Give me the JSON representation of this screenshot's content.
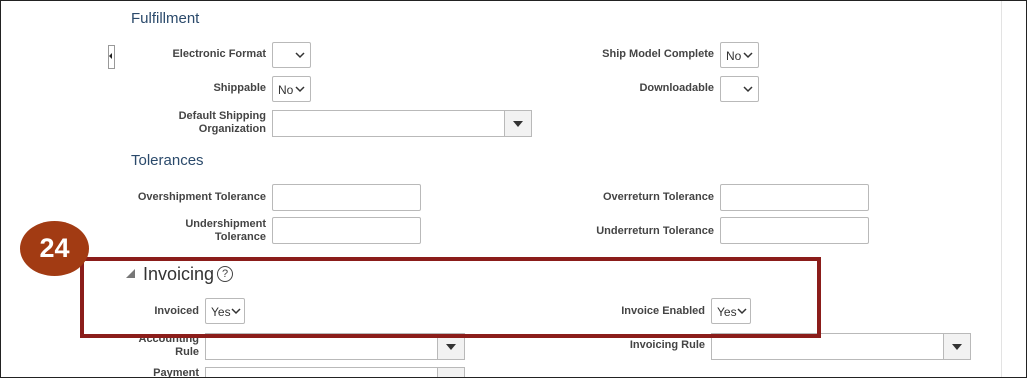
{
  "fulfillment": {
    "title": "Fulfillment",
    "electronic_format": {
      "label": "Electronic Format",
      "value": ""
    },
    "ship_model_complete": {
      "label": "Ship Model Complete",
      "value": "No"
    },
    "shippable": {
      "label": "Shippable",
      "value": "No"
    },
    "downloadable": {
      "label": "Downloadable",
      "value": ""
    },
    "default_shipping_org": {
      "label_line1": "Default Shipping",
      "label_line2": "Organization",
      "value": ""
    }
  },
  "tolerances": {
    "title": "Tolerances",
    "overshipment": {
      "label": "Overshipment Tolerance",
      "value": ""
    },
    "overreturn": {
      "label": "Overreturn Tolerance",
      "value": ""
    },
    "undershipment": {
      "label_line1": "Undershipment",
      "label_line2": "Tolerance",
      "value": ""
    },
    "underreturn": {
      "label": "Underreturn Tolerance",
      "value": ""
    }
  },
  "step_badge": "24",
  "invoicing": {
    "title": "Invoicing",
    "help_glyph": "?",
    "invoiced": {
      "label": "Invoiced",
      "value": "Yes"
    },
    "invoice_enabled": {
      "label": "Invoice Enabled",
      "value": "Yes"
    },
    "accounting_rule": {
      "label_line1": "Accounting",
      "label_line2": "Rule",
      "value": ""
    },
    "invoicing_rule": {
      "label": "Invoicing Rule",
      "value": ""
    },
    "payment": {
      "label": "Payment",
      "value": ""
    }
  },
  "colors": {
    "highlight": "#8b1d1a",
    "badge": "#a23b13",
    "section_title": "#2b4a6b"
  },
  "icons": [
    "chevron-down-icon",
    "dropdown-triangle-icon",
    "help-icon",
    "expanded-triangle-icon",
    "collapse-handle-icon"
  ]
}
